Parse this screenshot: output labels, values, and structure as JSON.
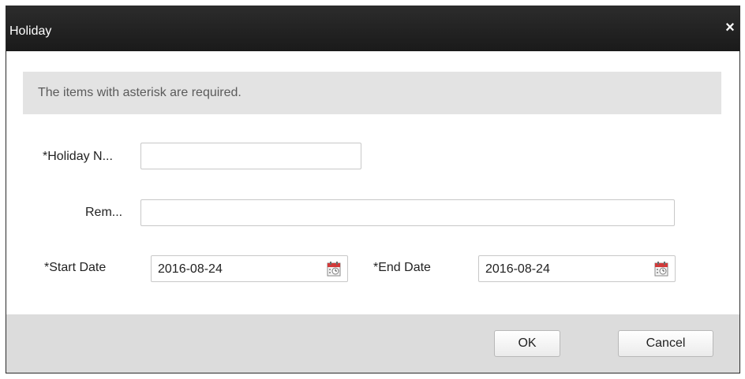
{
  "dialog": {
    "title": "Holiday",
    "close_glyph": "×",
    "notice": "The items with asterisk are required."
  },
  "form": {
    "holiday_name": {
      "label": "*Holiday N...",
      "value": ""
    },
    "remark": {
      "label": "Rem...",
      "value": ""
    },
    "start_date": {
      "label": "*Start Date",
      "value": "2016-08-24",
      "icon": "calendar-icon"
    },
    "end_date": {
      "label": "*End Date",
      "value": "2016-08-24",
      "icon": "calendar-icon"
    }
  },
  "buttons": {
    "ok_label": "OK",
    "cancel_label": "Cancel"
  },
  "colors": {
    "titlebar": "#222222",
    "notice_bg": "#e3e3e3",
    "footer_bg": "#dcdcdc",
    "calendar_accent": "#d23a3a"
  }
}
